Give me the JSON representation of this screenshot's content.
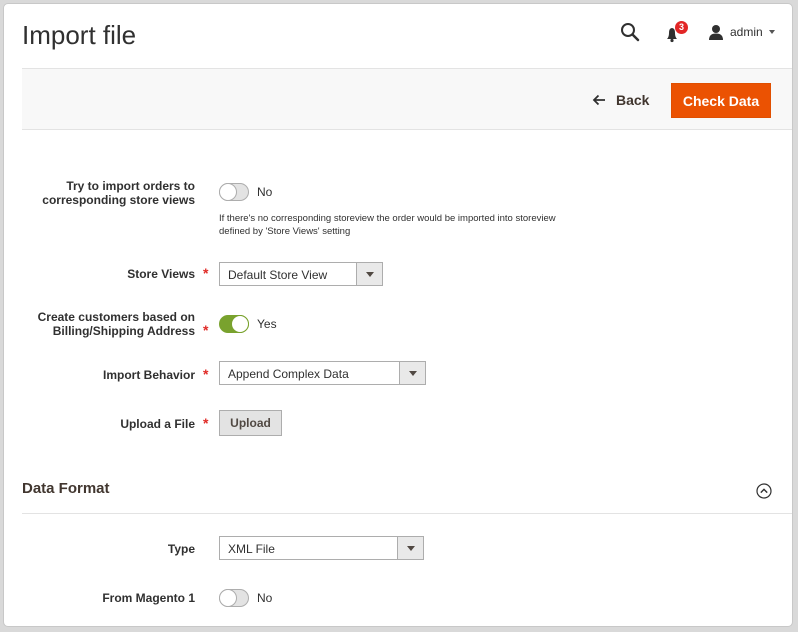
{
  "header": {
    "title": "Import file",
    "notifications_count": "3",
    "user_label": "admin"
  },
  "actions": {
    "back_label": "Back",
    "check_label": "Check Data"
  },
  "form": {
    "try_import": {
      "label_line1": "Try to import orders to",
      "label_line2": "corresponding store views",
      "value_text": "No",
      "enabled": false,
      "note_line1": "If there's no corresponding storeview the order would be imported into storeview",
      "note_line2": "defined by 'Store Views' setting"
    },
    "store_views": {
      "label": "Store Views",
      "required": "*",
      "value": "Default Store View"
    },
    "create_customers": {
      "label_line1": "Create customers based on",
      "label_line2": "Billing/Shipping Address",
      "required": "*",
      "value_text": "Yes",
      "enabled": true
    },
    "import_behavior": {
      "label": "Import Behavior",
      "required": "*",
      "value": "Append Complex Data"
    },
    "upload_file": {
      "label": "Upload a File",
      "required": "*",
      "button_label": "Upload"
    }
  },
  "data_format": {
    "title": "Data Format",
    "type": {
      "label": "Type",
      "value": "XML File"
    },
    "from_magento1": {
      "label": "From Magento 1",
      "value_text": "No",
      "enabled": false
    }
  },
  "colors": {
    "accent": "#eb5202",
    "toggle_on": "#79a22e",
    "required": "#e02b27",
    "badge": "#e22626"
  },
  "icons": {
    "search": "search-icon",
    "notifications": "bell-icon",
    "user": "user-icon",
    "back": "arrow-left-icon",
    "collapse": "chevron-up-circle-icon"
  }
}
